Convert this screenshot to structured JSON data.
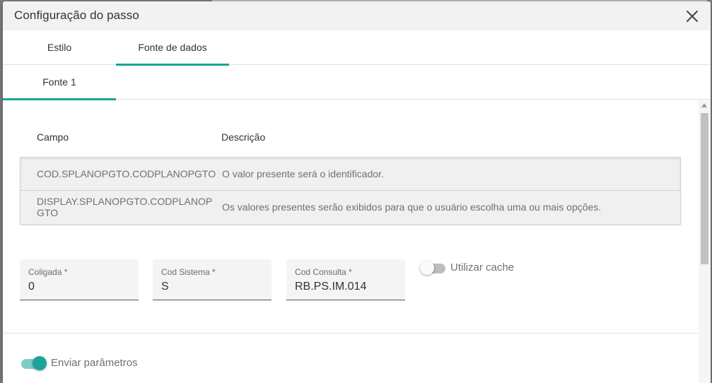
{
  "dialog": {
    "title": "Configuração do passo"
  },
  "tabs": [
    {
      "label": "Estilo",
      "active": false
    },
    {
      "label": "Fonte de dados",
      "active": true
    }
  ],
  "subtabs": [
    {
      "label": "Fonte 1",
      "active": true
    }
  ],
  "table": {
    "headers": {
      "campo": "Campo",
      "descricao": "Descrição"
    },
    "rows": [
      {
        "campo": "COD.SPLANOPGTO.CODPLANOPGTO",
        "descricao": "O valor presente será o identificador."
      },
      {
        "campo": "DISPLAY.SPLANOPGTO.CODPLANOPGTO",
        "descricao": "Os valores presentes serão exibidos para que o usuário escolha uma ou mais opções."
      }
    ]
  },
  "fields": {
    "coligada": {
      "label": "Coligada *",
      "value": "0"
    },
    "cod_sistema": {
      "label": "Cod Sistema *",
      "value": "S"
    },
    "cod_consulta": {
      "label": "Cod Consulta *",
      "value": "RB.PS.IM.014"
    }
  },
  "toggles": {
    "utilizar_cache": {
      "label": "Utilizar cache",
      "on": false
    },
    "enviar_parametros": {
      "label": "Enviar parâmetros",
      "on": true
    }
  },
  "colors": {
    "accent": "#1ba39c",
    "accent_light": "#7fcbc6"
  },
  "icons": {
    "close": "close-icon"
  }
}
